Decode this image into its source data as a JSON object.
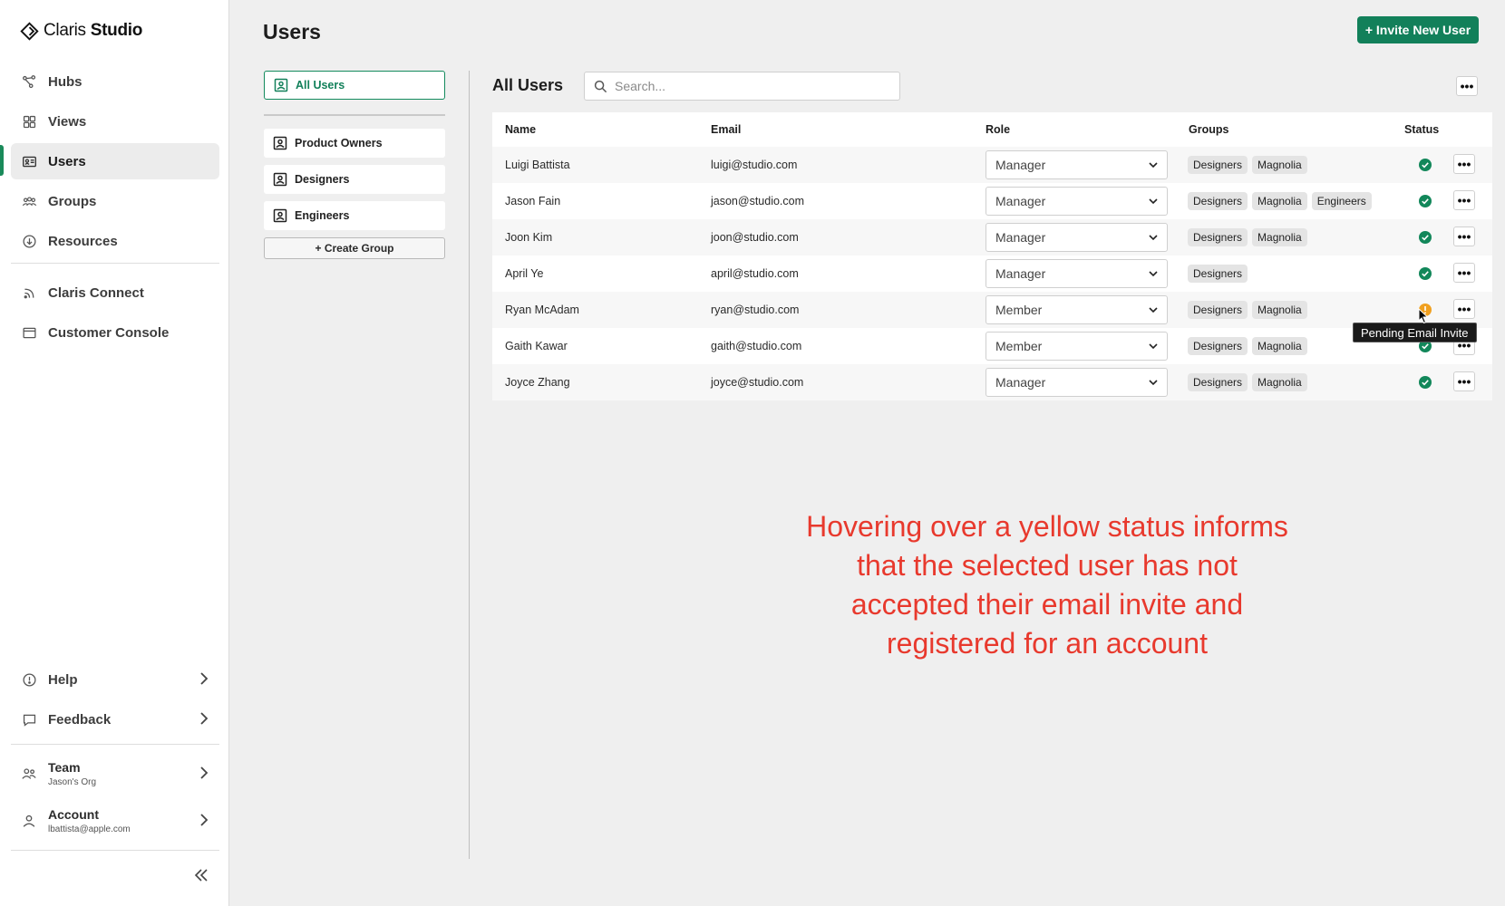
{
  "brand": {
    "name_light": "Claris",
    "name_bold": "Studio"
  },
  "sidebar": {
    "primary": [
      {
        "label": "Hubs",
        "icon": "hubs-icon"
      },
      {
        "label": "Views",
        "icon": "grid-icon"
      },
      {
        "label": "Users",
        "icon": "user-card-icon",
        "active": true
      },
      {
        "label": "Groups",
        "icon": "group-icon"
      },
      {
        "label": "Resources",
        "icon": "download-icon"
      }
    ],
    "secondary": [
      {
        "label": "Claris Connect",
        "icon": "rss-icon"
      },
      {
        "label": "Customer Console",
        "icon": "window-icon"
      }
    ],
    "bottom": [
      {
        "label": "Help",
        "icon": "info-icon"
      },
      {
        "label": "Feedback",
        "icon": "chat-icon"
      }
    ],
    "team": {
      "title": "Team",
      "subtitle": "Jason's Org"
    },
    "account": {
      "title": "Account",
      "subtitle": "lbattista@apple.com"
    },
    "accent_color": "#1a8a5a"
  },
  "header": {
    "title": "Users",
    "invite_label": "+ Invite New User"
  },
  "groups_panel": {
    "all_label": "All Users",
    "groups": [
      "Product Owners",
      "Designers",
      "Engineers"
    ],
    "create_label": "+ Create Group"
  },
  "users_panel": {
    "title": "All Users",
    "search_placeholder": "Search...",
    "columns": {
      "name": "Name",
      "email": "Email",
      "role": "Role",
      "groups": "Groups",
      "status": "Status"
    },
    "rows": [
      {
        "name": "Luigi Battista",
        "email": "luigi@studio.com",
        "role": "Manager",
        "groups": [
          "Designers",
          "Magnolia"
        ],
        "status": "active"
      },
      {
        "name": "Jason Fain",
        "email": "jason@studio.com",
        "role": "Manager",
        "groups": [
          "Designers",
          "Magnolia",
          "Engineers"
        ],
        "status": "active"
      },
      {
        "name": "Joon Kim",
        "email": "joon@studio.com",
        "role": "Manager",
        "groups": [
          "Designers",
          "Magnolia"
        ],
        "status": "active"
      },
      {
        "name": "April Ye",
        "email": "april@studio.com",
        "role": "Manager",
        "groups": [
          "Designers"
        ],
        "status": "active"
      },
      {
        "name": "Ryan McAdam",
        "email": "ryan@studio.com",
        "role": "Member",
        "groups": [
          "Designers",
          "Magnolia"
        ],
        "status": "pending"
      },
      {
        "name": "Gaith Kawar",
        "email": "gaith@studio.com",
        "role": "Member",
        "groups": [
          "Designers",
          "Magnolia"
        ],
        "status": "active"
      },
      {
        "name": "Joyce Zhang",
        "email": "joyce@studio.com",
        "role": "Manager",
        "groups": [
          "Designers",
          "Magnolia"
        ],
        "status": "active"
      }
    ],
    "status_colors": {
      "active": "#12875a",
      "pending": "#f0a020"
    }
  },
  "tooltip": {
    "text": "Pending Email Invite"
  },
  "annotation": {
    "text": "Hovering over a yellow status informs that the selected user has not accepted their email invite and registered for an account",
    "color": "#e8392d"
  }
}
